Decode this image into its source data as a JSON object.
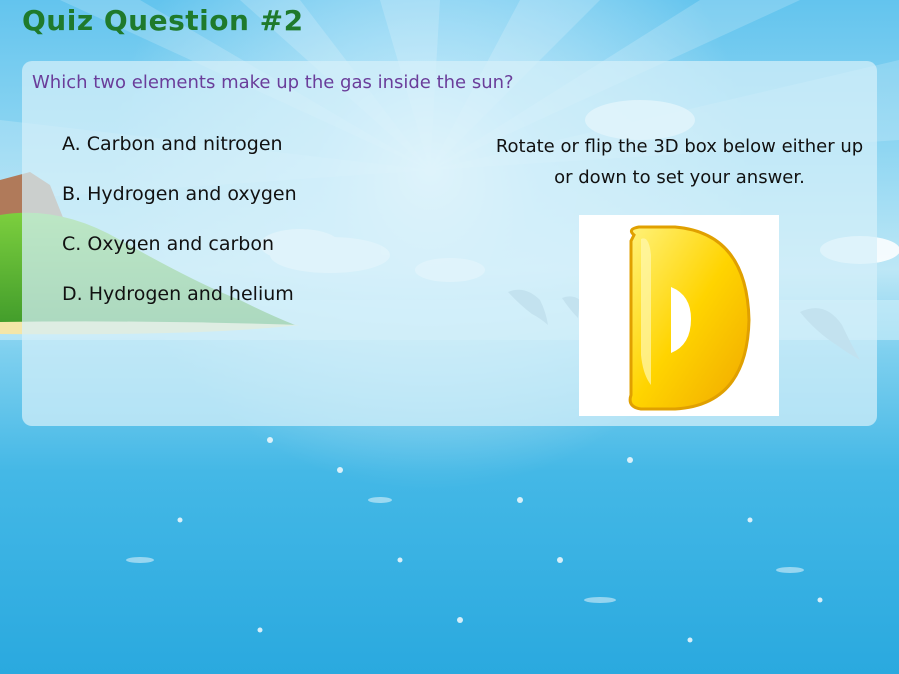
{
  "quiz": {
    "title": "Quiz Question #2",
    "question": "Which two elements make up the gas inside the sun?",
    "options": [
      {
        "label": "A. Carbon and nitrogen"
      },
      {
        "label": "B. Hydrogen and oxygen"
      },
      {
        "label": "C. Oxygen and carbon"
      },
      {
        "label": "D. Hydrogen and helium"
      }
    ],
    "instruction": "Rotate or flip the 3D box below either up or down to set your answer.",
    "answer_box": {
      "letter": "D",
      "color": "#ffd400"
    }
  }
}
